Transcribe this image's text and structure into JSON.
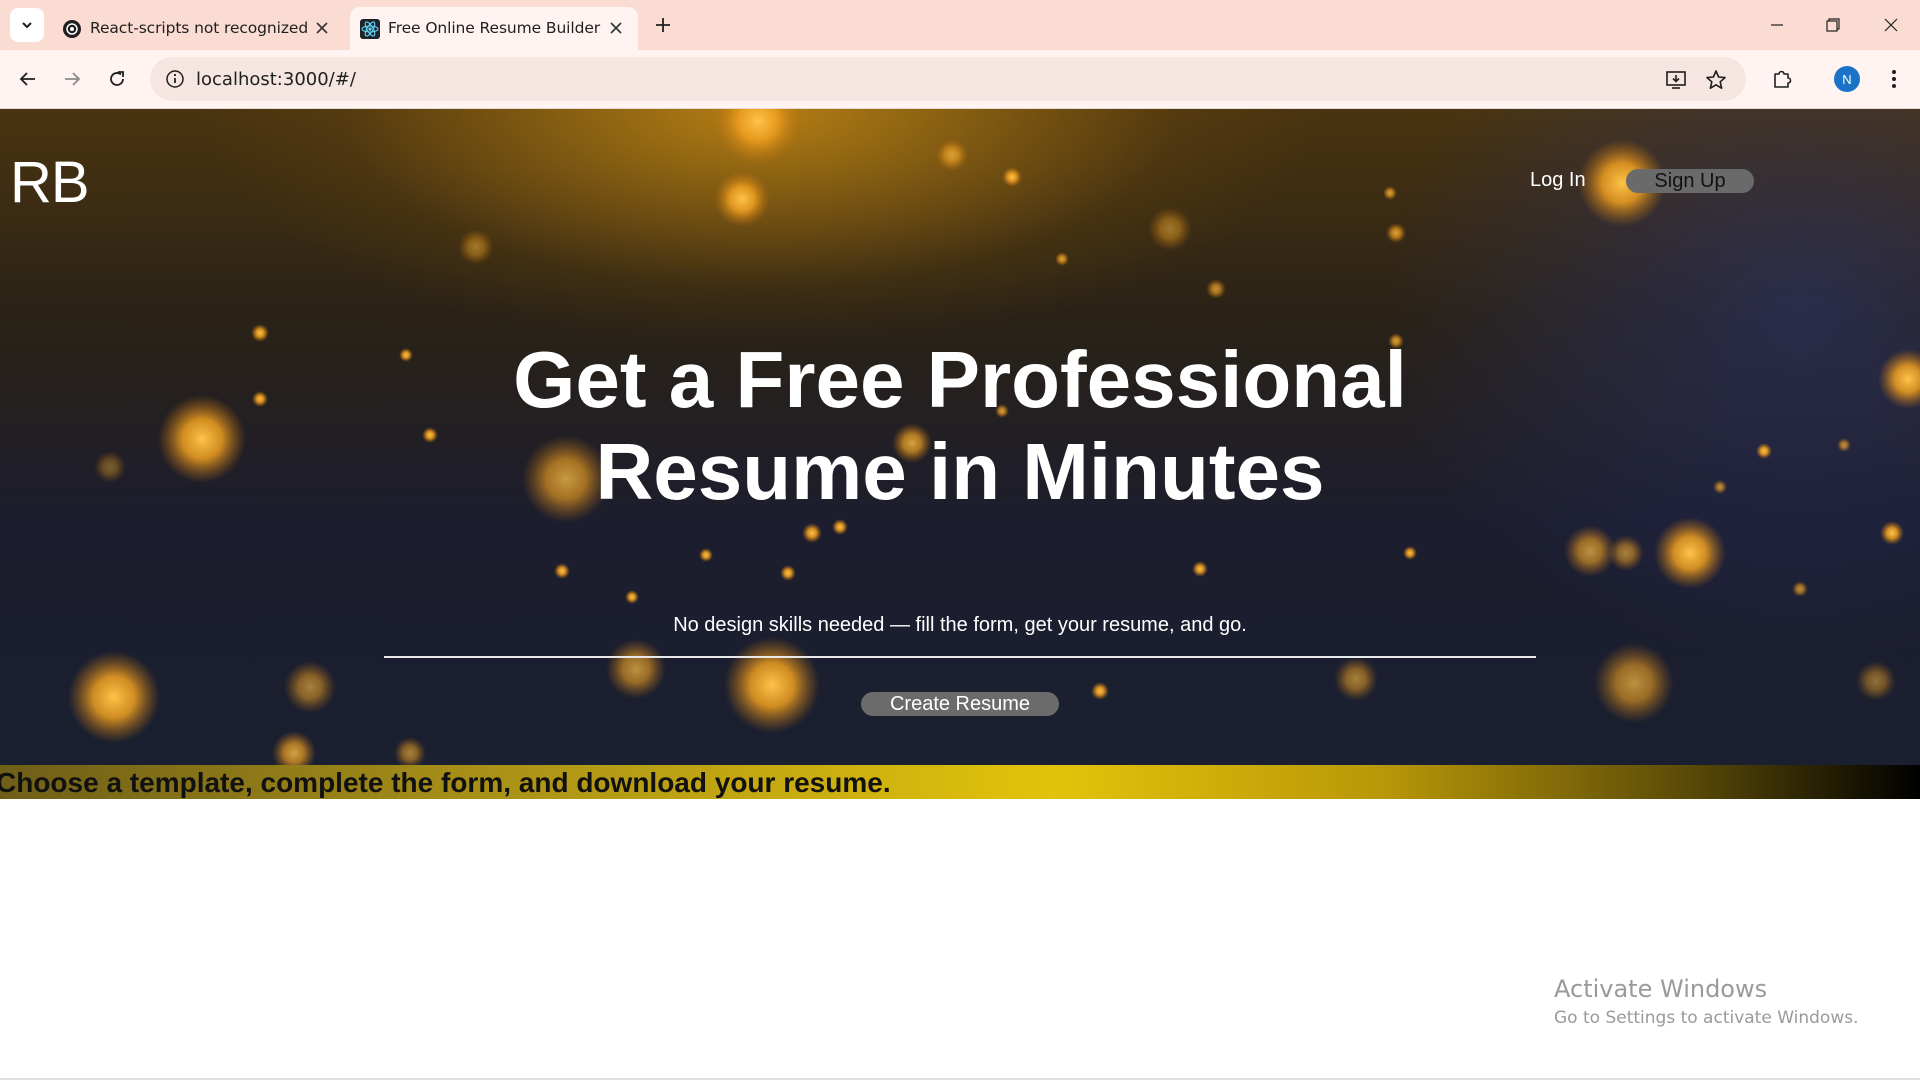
{
  "browser": {
    "tabs": [
      {
        "title": "React-scripts not recognized",
        "active": false
      },
      {
        "title": "Free Online Resume Builder",
        "active": true
      }
    ],
    "url": "localhost:3000/#/",
    "profile_initial": "N",
    "colors": {
      "tabstrip": "#fbdcd3",
      "toolbar": "#fff4f1",
      "omnibox": "#f6e6e2",
      "avatar": "#1a73c7"
    }
  },
  "page": {
    "brand": "RB",
    "nav": {
      "login": "Log In",
      "signup": "Sign Up"
    },
    "headline_line1": "Get a Free Professional",
    "headline_line2": "Resume in Minutes",
    "subtext": "No design skills needed — fill the form, get your resume, and go.",
    "cta": "Create Resume",
    "ticker": "Choose a template, complete the form, and download your resume."
  },
  "watermark": {
    "title": "Activate Windows",
    "subtitle": "Go to Settings to activate Windows."
  }
}
